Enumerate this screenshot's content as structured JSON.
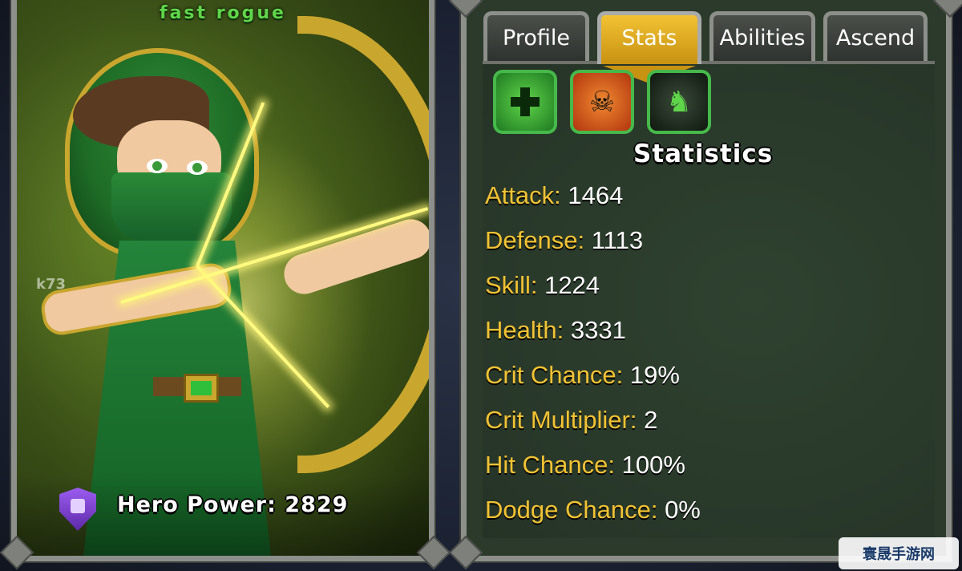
{
  "hero": {
    "name": "fast rogue",
    "power_label": "Hero Power:",
    "power_value": "2829",
    "watermark": "k73"
  },
  "tabs": [
    {
      "label": "Profile",
      "active": false
    },
    {
      "label": "Stats",
      "active": true
    },
    {
      "label": "Abilities",
      "active": false
    },
    {
      "label": "Ascend",
      "active": false
    }
  ],
  "ability_icons": [
    {
      "name": "heal-ability-icon"
    },
    {
      "name": "fire-ability-icon"
    },
    {
      "name": "shadow-ability-icon"
    }
  ],
  "statistics": {
    "title": "Statistics",
    "items": [
      {
        "label": "Attack:",
        "value": "1464"
      },
      {
        "label": "Defense:",
        "value": "1113"
      },
      {
        "label": "Skill:",
        "value": "1224"
      },
      {
        "label": "Health:",
        "value": "3331"
      },
      {
        "label": "Crit Chance:",
        "value": "19%"
      },
      {
        "label": "Crit Multiplier:",
        "value": "2"
      },
      {
        "label": "Hit Chance:",
        "value": "100%"
      },
      {
        "label": "Dodge Chance:",
        "value": "0%"
      }
    ]
  },
  "colors": {
    "label_gold": "#f2c233",
    "value_white": "#ffffff",
    "name_green": "#5fd54a"
  },
  "site_logo": "寰晟手游网"
}
